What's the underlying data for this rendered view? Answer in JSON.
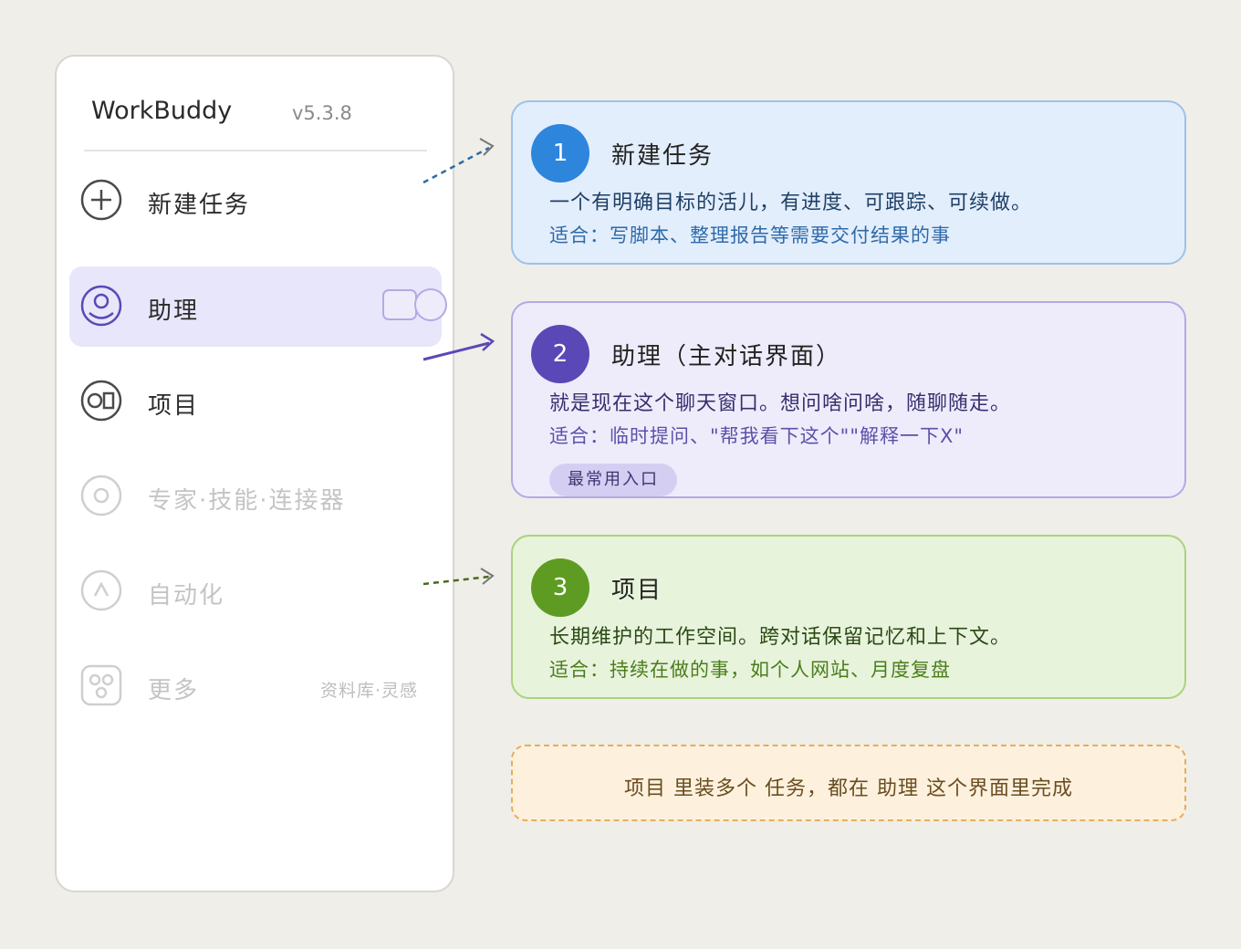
{
  "app": {
    "title": "WorkBuddy",
    "version": "v5.3.8"
  },
  "sidebar": {
    "items": [
      {
        "label": "新建任务",
        "icon": "plus-circle-icon",
        "state": "normal"
      },
      {
        "label": "助理",
        "icon": "assistant-icon",
        "state": "active"
      },
      {
        "label": "项目",
        "icon": "project-icon",
        "state": "normal"
      },
      {
        "label": "专家·技能·连接器",
        "icon": "expert-icon",
        "state": "disabled"
      },
      {
        "label": "自动化",
        "icon": "automation-icon",
        "state": "disabled"
      },
      {
        "label": "更多",
        "icon": "more-grid-icon",
        "state": "disabled",
        "meta": "资料库·灵感"
      }
    ]
  },
  "cards": [
    {
      "number": "1",
      "title": "新建任务",
      "description": "一个有明确目标的活儿，有进度、可跟踪、可续做。",
      "note": "适合：写脚本、整理报告等需要交付结果的事",
      "accent": "#2d86dc"
    },
    {
      "number": "2",
      "title": "助理（主对话界面）",
      "description": "就是现在这个聊天窗口。想问啥问啥，随聊随走。",
      "note": "适合：临时提问、\"帮我看下这个\"\"解释一下X\"",
      "tag": "最常用入口",
      "accent": "#5a48b6"
    },
    {
      "number": "3",
      "title": "项目",
      "description": "长期维护的工作空间。跨对话保留记忆和上下文。",
      "note": "适合：持续在做的事，如个人网站、月度复盘",
      "accent": "#5e9b22"
    }
  ],
  "footer": {
    "text": "项目 里装多个 任务，都在 助理 这个界面里完成"
  },
  "colors": {
    "background": "#efeee9",
    "active_bg": "#e8e6fa",
    "footer_border": "#e7ad5e"
  }
}
